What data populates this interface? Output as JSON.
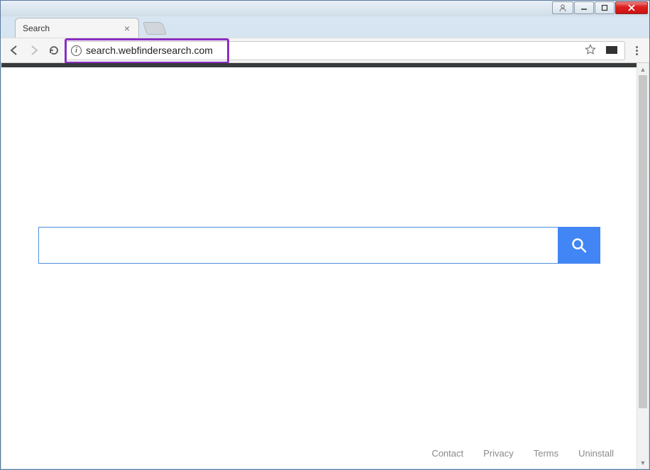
{
  "window": {
    "buttons": {
      "user": "user-icon",
      "minimize": "minimize",
      "maximize": "maximize",
      "close": "close"
    }
  },
  "browser": {
    "tab_title": "Search",
    "url": "search.webfindersearch.com",
    "nav": {
      "back_enabled": true,
      "forward_enabled": false
    },
    "highlight_color": "#8a2fc4"
  },
  "page": {
    "search_value": "",
    "accent_color": "#4285f4",
    "border_color": "#4a90e2",
    "top_strip_color": "#383a3c",
    "footer": [
      "Contact",
      "Privacy",
      "Terms",
      "Uninstall"
    ]
  }
}
